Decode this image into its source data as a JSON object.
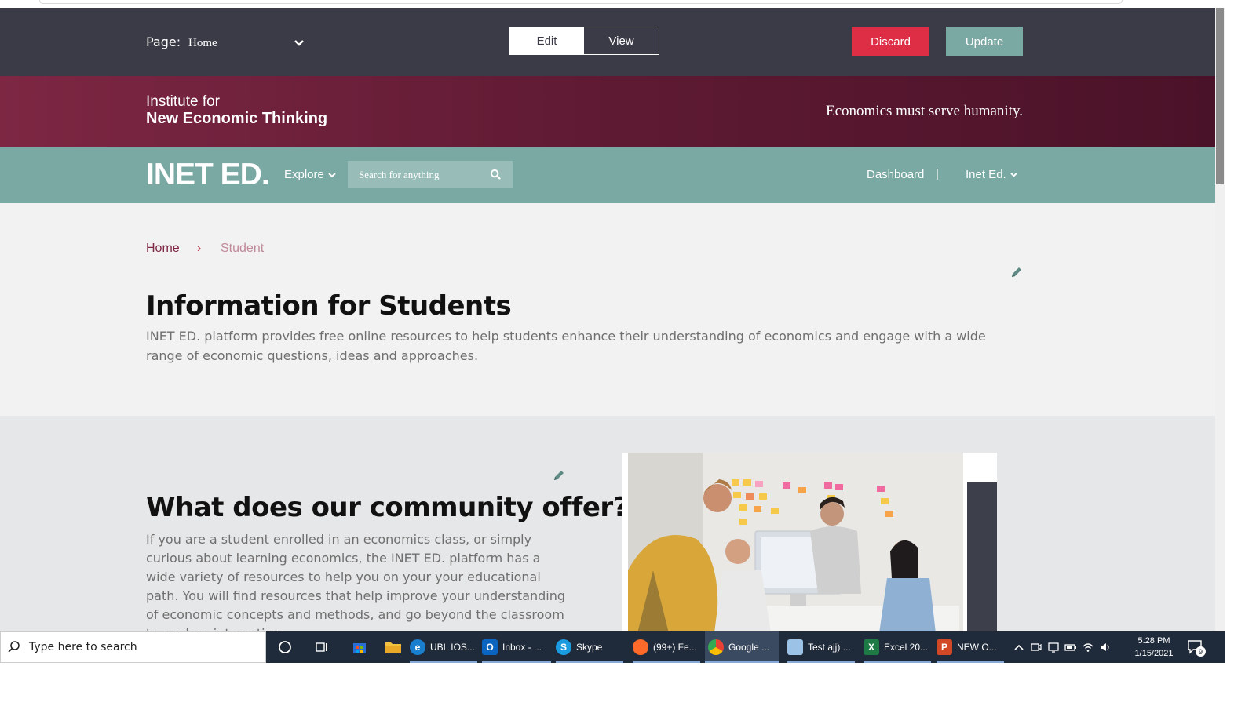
{
  "editor": {
    "page_label": "Page:",
    "page_value": "Home",
    "mode_edit": "Edit",
    "mode_view": "View",
    "discard": "Discard",
    "update": "Update"
  },
  "hero": {
    "logo_line1": "Institute for",
    "logo_line2": "New Economic Thinking",
    "tagline": "Economics must serve humanity."
  },
  "nav": {
    "brand": "INET ED.",
    "explore": "Explore",
    "search_placeholder": "Search for anything",
    "dashboard": "Dashboard",
    "separator": "|",
    "user": "Inet Ed."
  },
  "breadcrumb": {
    "home": "Home",
    "separator": "›",
    "current": "Student"
  },
  "section1": {
    "title": "Information for Students",
    "description": "INET ED. platform provides free online resources to help students enhance their understanding of economics and engage with a wide range of economic questions, ideas and approaches."
  },
  "section2": {
    "title": "What does our community offer?",
    "description": "If you are a student enrolled in an economics class, or simply curious about learning economics, the INET ED. platform has a wide variety of resources to help you on your your educational path. You will find resources that help improve your understanding of economic concepts and methods, and go beyond the classroom to explore interesting"
  },
  "taskbar": {
    "search_text": "Type here to search",
    "apps": [
      {
        "label": "UBL IOS...",
        "icon": "edge-icon"
      },
      {
        "label": "Inbox - ...",
        "icon": "outlook-icon"
      },
      {
        "label": "Skype",
        "icon": "skype-icon"
      },
      {
        "label": "(99+) Fe...",
        "icon": "firefox-icon"
      },
      {
        "label": "Google ...",
        "icon": "chrome-icon"
      },
      {
        "label": "Test ajj) ...",
        "icon": "notepad-icon"
      },
      {
        "label": "Excel 20...",
        "icon": "excel-icon"
      },
      {
        "label": "NEW O...",
        "icon": "powerpoint-icon"
      }
    ],
    "time": "5:28 PM",
    "date": "1/15/2021",
    "notification_count": "9"
  },
  "colors": {
    "editor_bar": "#3a3b47",
    "discard": "#de2e45",
    "accent_teal": "#7aa9a3",
    "hero_maroon": "#7d2743"
  }
}
